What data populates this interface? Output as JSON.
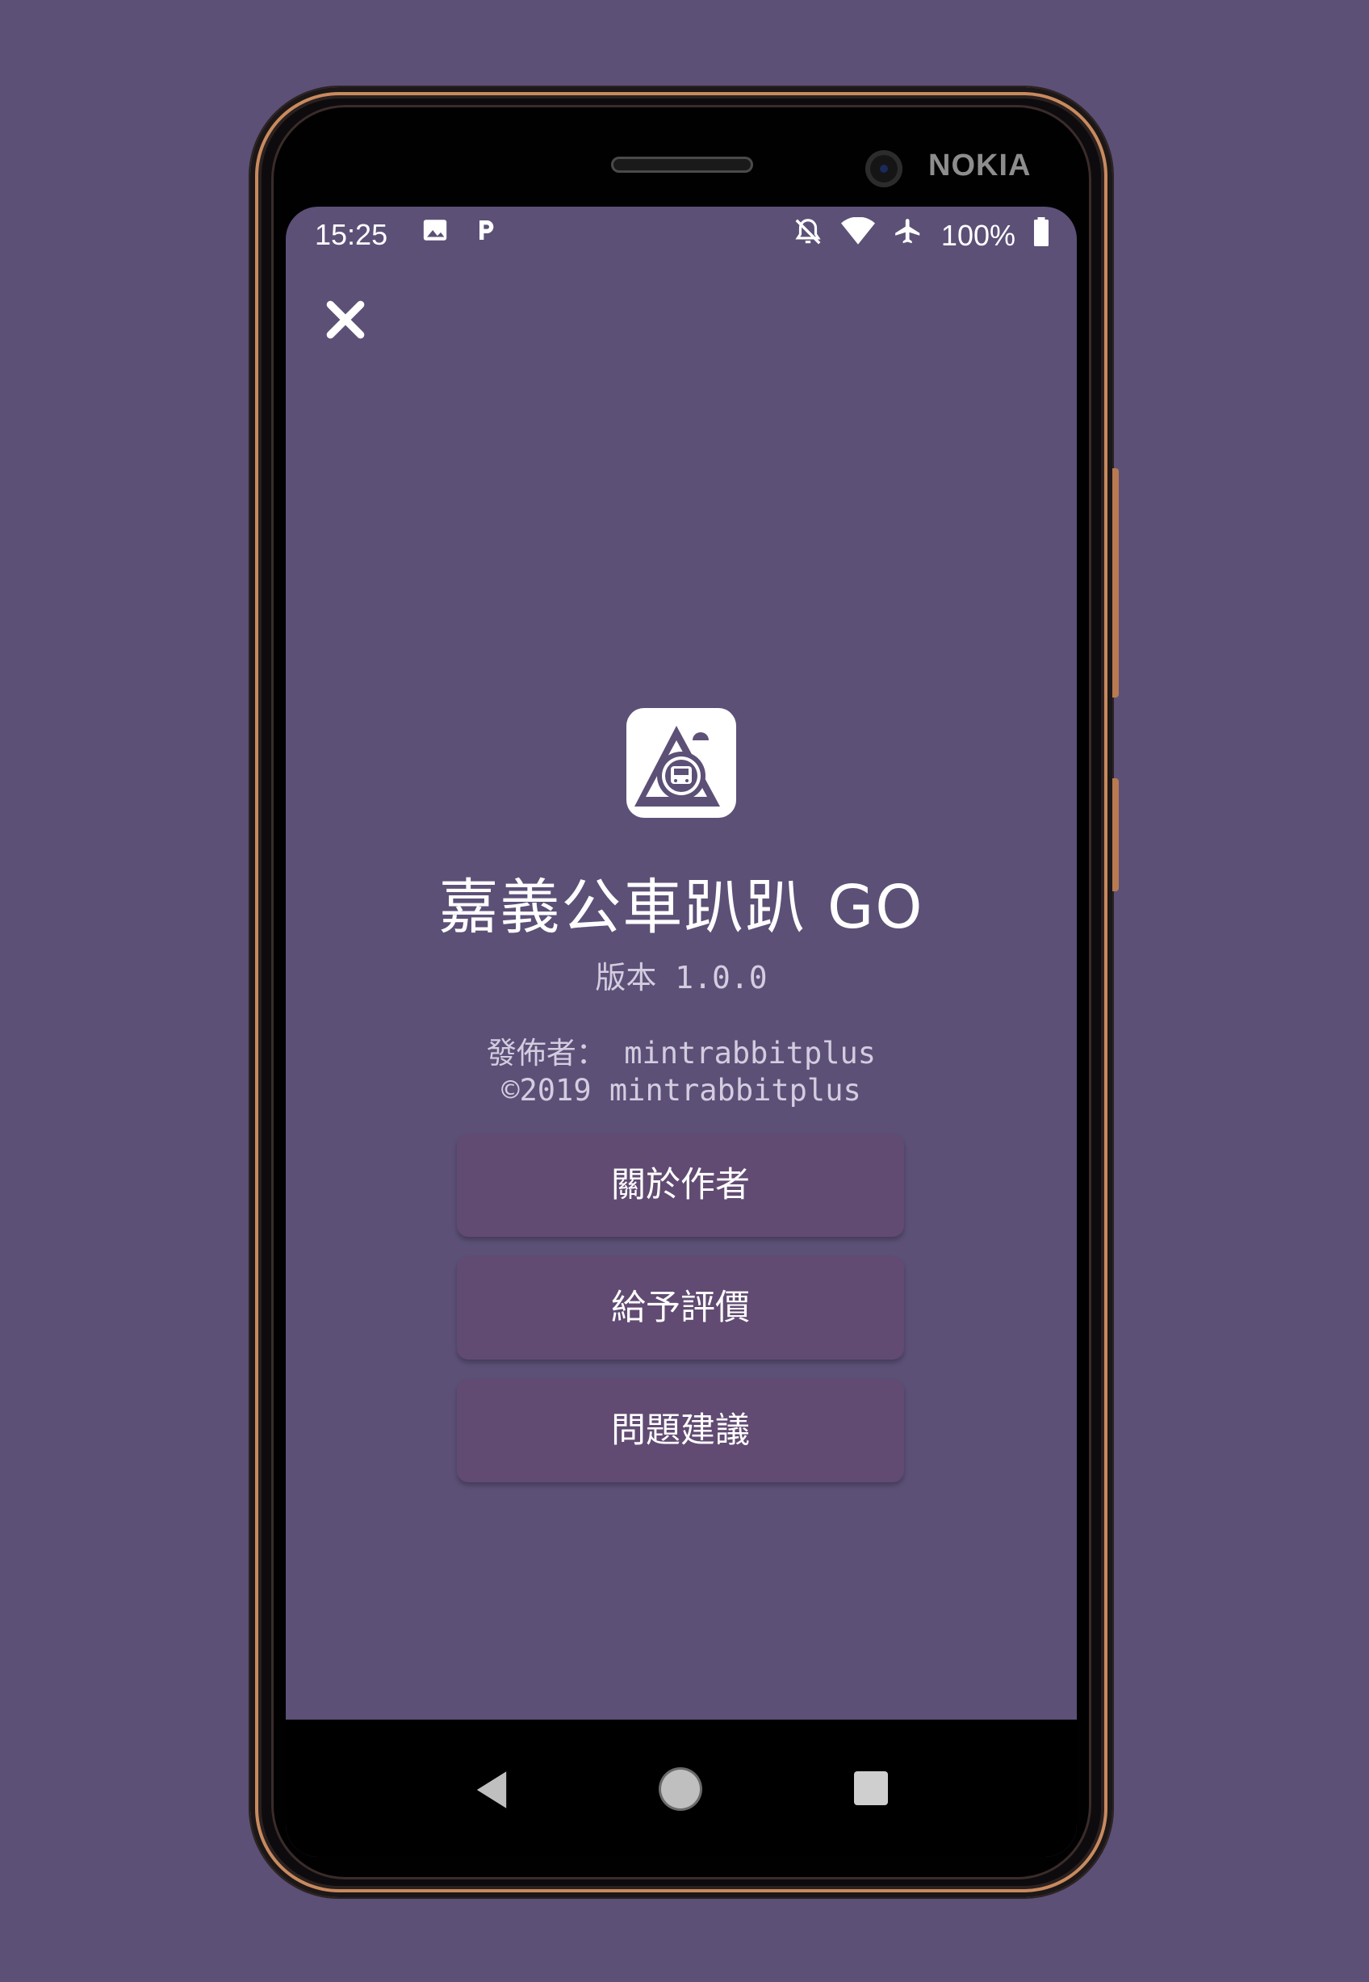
{
  "device": {
    "brand": "NOKIA"
  },
  "status_bar": {
    "time": "15:25",
    "battery": "100%",
    "left_icons": [
      "image-icon",
      "parking-icon"
    ],
    "right_icons": [
      "notifications-off-icon",
      "wifi-icon",
      "airplane-mode-icon",
      "battery-icon"
    ]
  },
  "about": {
    "close_icon": "close-icon",
    "app_icon": "app-logo",
    "app_title": "嘉義公車趴趴 GO",
    "version": "版本 1.0.0",
    "publisher": "發佈者： mintrabbitplus",
    "copyright": "©2019 mintrabbitplus",
    "buttons": [
      {
        "label": "關於作者"
      },
      {
        "label": "給予評價"
      },
      {
        "label": "問題建議"
      }
    ]
  },
  "nav_bar": {
    "icons": [
      "back-icon",
      "home-icon",
      "recents-icon"
    ]
  },
  "colors": {
    "background": "#5c5077",
    "button": "#614b72",
    "text": "#ffffff",
    "subtext": "#d3cde0"
  }
}
